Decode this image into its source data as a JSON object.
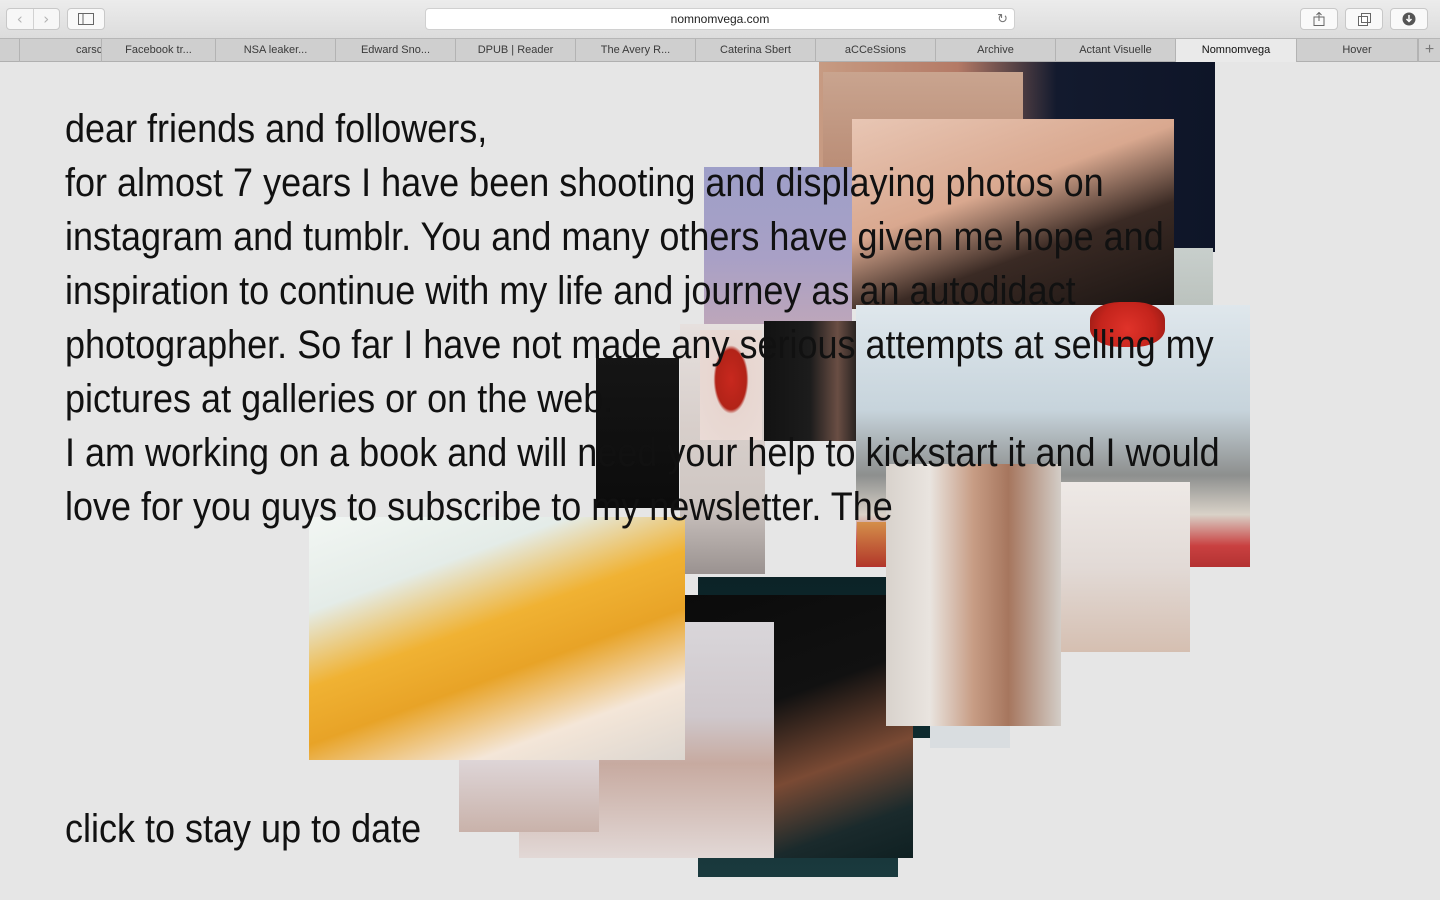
{
  "browser": {
    "url": "nomnomvega.com",
    "tabs": [
      {
        "label": "carsc",
        "active": false
      },
      {
        "label": "Facebook tr...",
        "active": false
      },
      {
        "label": "NSA leaker...",
        "active": false
      },
      {
        "label": "Edward Sno...",
        "active": false
      },
      {
        "label": "DPUB | Reader",
        "active": false
      },
      {
        "label": "The Avery R...",
        "active": false
      },
      {
        "label": "Caterina Sbert",
        "active": false
      },
      {
        "label": "aCCeSsions",
        "active": false
      },
      {
        "label": "Archive",
        "active": false
      },
      {
        "label": "Actant Visuelle",
        "active": false
      },
      {
        "label": "Nomnomvega",
        "active": true
      },
      {
        "label": "Hover",
        "active": false
      }
    ],
    "icons": {
      "back": "chevron-left-icon",
      "forward": "chevron-right-icon",
      "sidebar": "sidebar-icon",
      "reload": "reload-icon",
      "share": "share-icon",
      "tabs": "tab-overview-icon",
      "downloads": "download-icon",
      "add_tab": "plus-icon"
    }
  },
  "content": {
    "lines": [
      "dear friends and followers,",
      "for almost 7 years I have been shooting and displaying photos on",
      "instagram and tumblr. You and many others have given me hope and",
      "inspiration to continue with my life and journey as an autodidact",
      "photographer. So far I have not made any serious attempts at selling my",
      "pictures at galleries or on the web.",
      "I am working on a book and will need your help to kickstart it and I would",
      "love for you guys to subscribe to my newsletter. The"
    ],
    "cta": "click to stay up to date"
  },
  "colors": {
    "page_bg": "#e6e6e6",
    "text": "#111111"
  }
}
